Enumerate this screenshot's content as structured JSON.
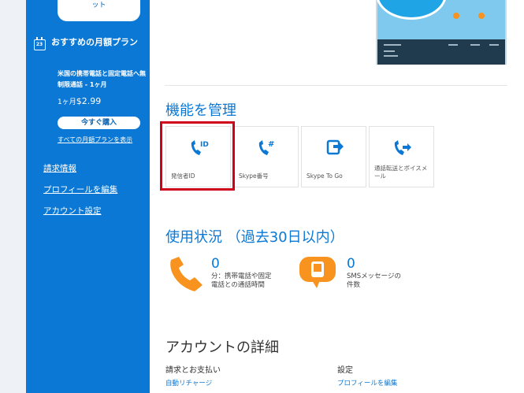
{
  "sidebar": {
    "promo_button": "クレジットと特典のメリット",
    "plan_icon_day": "23",
    "plan_title": "おすすめの月額プラン",
    "plan_description": "米国の携帯電話と固定電話へ無制限通話 - 1ヶ月",
    "plan_price_prefix": "1ヶ月",
    "plan_price": "$2.99",
    "buy_button": "今すぐ購入",
    "all_plans_link": "すべての月額プランを表示",
    "links": [
      "請求情報",
      "プロフィールを編集",
      "アカウント設定"
    ]
  },
  "manage": {
    "title": "機能を管理",
    "tiles": [
      {
        "label": "発信者ID",
        "icon": "caller-id-icon"
      },
      {
        "label": "Skype番号",
        "icon": "skype-number-icon"
      },
      {
        "label": "Skype To Go",
        "icon": "skype-to-go-icon"
      },
      {
        "label": "通話転送とボイスメール",
        "icon": "call-forwarding-icon"
      }
    ]
  },
  "usage": {
    "title": "使用状況 （過去30日以内）",
    "calls_count": "0",
    "calls_label": "分：携帯電話や固定電話との通話時間",
    "sms_count": "0",
    "sms_label": "SMSメッセージの件数"
  },
  "account": {
    "title": "アカウントの詳細",
    "billing_label": "請求とお支払い",
    "auto_recharge_link": "自動リチャージ",
    "settings_label": "設定",
    "edit_profile_link": "プロフィールを編集"
  },
  "colors": {
    "sidebar_blue": "#0a78d4",
    "accent_orange": "#f7931e",
    "highlight_red": "#d0021b"
  }
}
